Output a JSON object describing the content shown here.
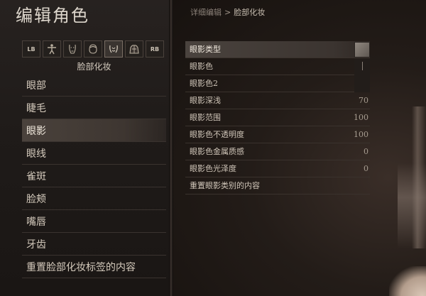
{
  "title": "编辑角色",
  "breadcrumb": {
    "parent": "详细编辑",
    "separator": ">",
    "current": "脸部化妆"
  },
  "tabs": [
    {
      "label": "LB",
      "icon": "lb-bumper-icon"
    },
    {
      "label": "",
      "icon": "body-figure-icon"
    },
    {
      "label": "",
      "icon": "face-icon"
    },
    {
      "label": "",
      "icon": "head-hair-icon"
    },
    {
      "label": "",
      "icon": "makeup-face-icon"
    },
    {
      "label": "",
      "icon": "armor-outfit-icon"
    },
    {
      "label": "RB",
      "icon": "rb-bumper-icon"
    }
  ],
  "active_tab": 4,
  "section_title": "脸部化妆",
  "left_menu": [
    {
      "label": "眼部"
    },
    {
      "label": "睫毛"
    },
    {
      "label": "眼影"
    },
    {
      "label": "眼线"
    },
    {
      "label": "雀斑"
    },
    {
      "label": "脸颊"
    },
    {
      "label": "嘴唇"
    },
    {
      "label": "牙齿"
    },
    {
      "label": "重置脸部化妆标签的内容"
    }
  ],
  "left_active_index": 2,
  "right_menu": [
    {
      "label": "眼影类型",
      "value": ""
    },
    {
      "label": "眼影色",
      "value": ""
    },
    {
      "label": "眼影色2",
      "value": ""
    },
    {
      "label": "眼影深浅",
      "value": "70"
    },
    {
      "label": "眼影范围",
      "value": "100"
    },
    {
      "label": "眼影色不透明度",
      "value": "100"
    },
    {
      "label": "眼影色金属质感",
      "value": "0"
    },
    {
      "label": "眼影色光泽度",
      "value": "0"
    },
    {
      "label": "重置眼影类别的内容",
      "value": ""
    }
  ],
  "right_active_index": 0,
  "colors": {
    "accent": "#4a423c",
    "text": "#d4cabc",
    "muted": "#8a8078"
  }
}
